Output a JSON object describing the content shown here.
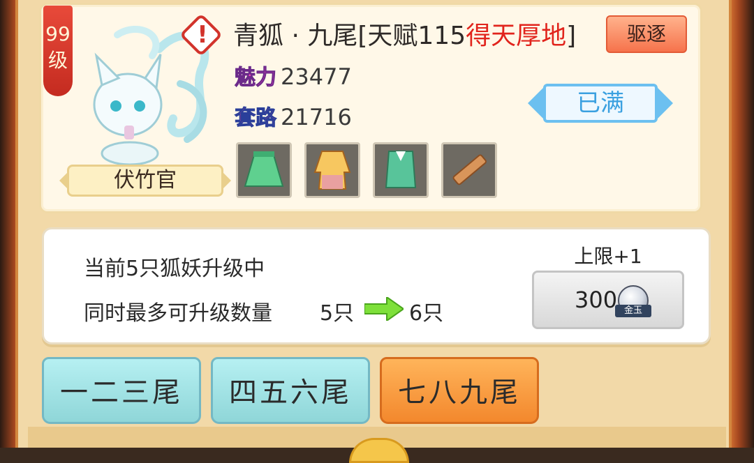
{
  "servant": {
    "level": "99",
    "level_unit": "级",
    "title": "伏竹官",
    "name": "青狐 · 九尾",
    "talent_prefix": "[天赋115",
    "talent_type": "得天厚地",
    "talent_suffix": "]",
    "expel_label": "驱逐",
    "status_label": "已满",
    "stats": [
      {
        "label": "魅力",
        "value": "23477"
      },
      {
        "label": "套路",
        "value": "21716"
      }
    ],
    "equipment": [
      "green-skirt",
      "yellow-robe",
      "green-vest",
      "wooden-plank"
    ]
  },
  "upgrade": {
    "current_text": "当前5只狐妖升级中",
    "max_label": "同时最多可升级数量",
    "from_value": "5只",
    "to_value": "6只",
    "limit_label": "上限+1",
    "cost": "300",
    "currency_tag": "金玉"
  },
  "tabs": [
    {
      "label": "一二三尾",
      "active": false
    },
    {
      "label": "四五六尾",
      "active": false
    },
    {
      "label": "七八九尾",
      "active": true
    }
  ],
  "colors": {
    "talent_red": "#e1241c",
    "status_blue": "#3aa0e0",
    "active_tab": "#f3882d",
    "inactive_tab": "#8fd6d8"
  }
}
